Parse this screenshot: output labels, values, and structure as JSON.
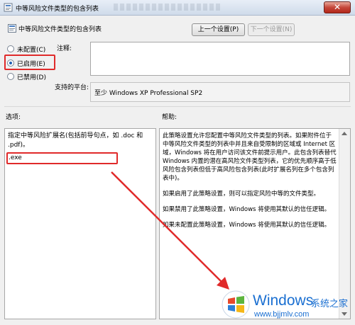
{
  "window": {
    "title": "中等风险文件类型的包含列表",
    "close_glyph": "✕"
  },
  "header": {
    "title": "中等风险文件类型的包含列表",
    "prev_button": "上一个设置(P)",
    "next_button": "下一个设置(N)"
  },
  "state_options": [
    {
      "label": "未配置(C)",
      "checked": false
    },
    {
      "label": "已启用(E)",
      "checked": true
    },
    {
      "label": "已禁用(D)",
      "checked": false
    }
  ],
  "comment": {
    "label": "注释:",
    "value": ""
  },
  "platform": {
    "label": "支持的平台:",
    "value": "至少 Windows XP Professional SP2"
  },
  "options": {
    "label": "选项:",
    "description": "指定中等风险扩展名(包括前导句点，如 .doc 和 .pdf)。",
    "extension_value": ".exe"
  },
  "help": {
    "label": "帮助:",
    "paragraphs": [
      "此策略设置允许您配置中等风险文件类型的列表。如果附件位于中等风险文件类型的列表中并且来自受限制的区域或 Internet 区域，Windows 将在用户访问该文件前提示用户。此包含列表替代 Windows 内置的潜在高风险文件类型列表，它的优先顺序高于低风险包含列表但低于高风险包含列表(此时扩展名列在多个包含列表中)。",
      "如果启用了此策略设置，则可以指定风险中等的文件类型。",
      "如果禁用了此策略设置，Windows 将使用其默认的信任逻辑。",
      "如果未配置此策略设置，Windows 将使用其默认的信任逻辑。"
    ]
  },
  "watermark": {
    "brand": "Windows",
    "cn": "系统之家",
    "url": "www.bjjmlv.com"
  },
  "colors": {
    "highlight_red": "#e02a2a",
    "brand_blue": "#1a6fd1"
  }
}
